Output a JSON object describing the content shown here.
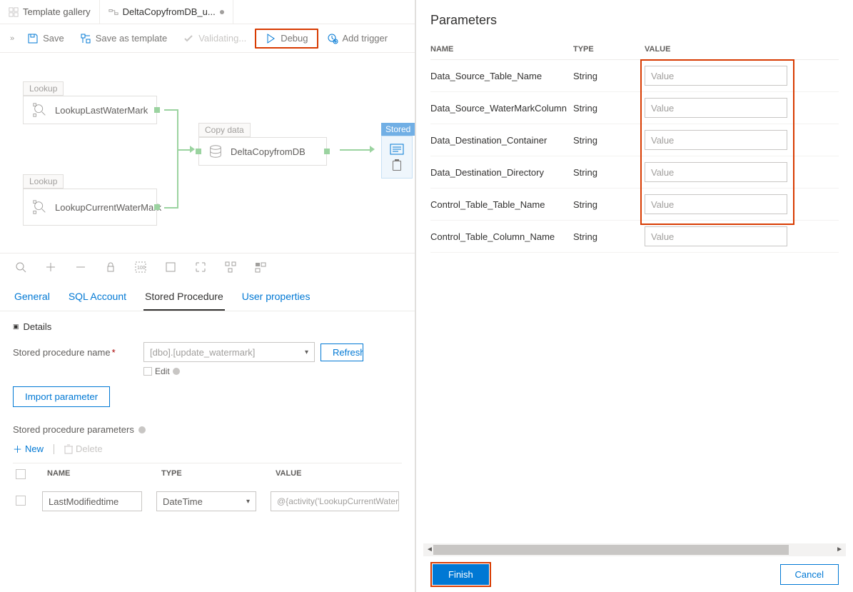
{
  "tabs": {
    "gallery": "Template gallery",
    "pipeline": "DeltaCopyfromDB_u..."
  },
  "toolbar": {
    "save": "Save",
    "save_as_template": "Save as template",
    "validating": "Validating...",
    "debug": "Debug",
    "add_trigger": "Add trigger"
  },
  "canvas": {
    "lookup_label": "Lookup",
    "copy_label": "Copy data",
    "stored_label": "Stored",
    "node_last": "LookupLastWaterMark",
    "node_current": "LookupCurrentWaterMark",
    "node_copy": "DeltaCopyfromDB"
  },
  "detail_tabs": {
    "general": "General",
    "sql": "SQL Account",
    "stored": "Stored Procedure",
    "user": "User properties"
  },
  "details": {
    "section": "Details",
    "sp_name_label": "Stored procedure name",
    "sp_name_value": "[dbo].[update_watermark]",
    "edit": "Edit",
    "refresh": "Refresh",
    "import": "Import parameter",
    "params_heading": "Stored procedure parameters",
    "new": "New",
    "delete": "Delete",
    "col_name": "NAME",
    "col_type": "TYPE",
    "col_value": "VALUE",
    "row": {
      "name": "LastModifiedtime",
      "type": "DateTime",
      "value": "@{activity('LookupCurrentWaterMut.firstRow.NewWatermarkValue}"
    }
  },
  "panel": {
    "title": "Parameters",
    "col_name": "NAME",
    "col_type": "TYPE",
    "col_value": "VALUE",
    "placeholder": "Value",
    "params": [
      {
        "name": "Data_Source_Table_Name",
        "type": "String"
      },
      {
        "name": "Data_Source_WaterMarkColumn",
        "type": "String"
      },
      {
        "name": "Data_Destination_Container",
        "type": "String"
      },
      {
        "name": "Data_Destination_Directory",
        "type": "String"
      },
      {
        "name": "Control_Table_Table_Name",
        "type": "String"
      },
      {
        "name": "Control_Table_Column_Name",
        "type": "String"
      }
    ],
    "finish": "Finish",
    "cancel": "Cancel"
  }
}
